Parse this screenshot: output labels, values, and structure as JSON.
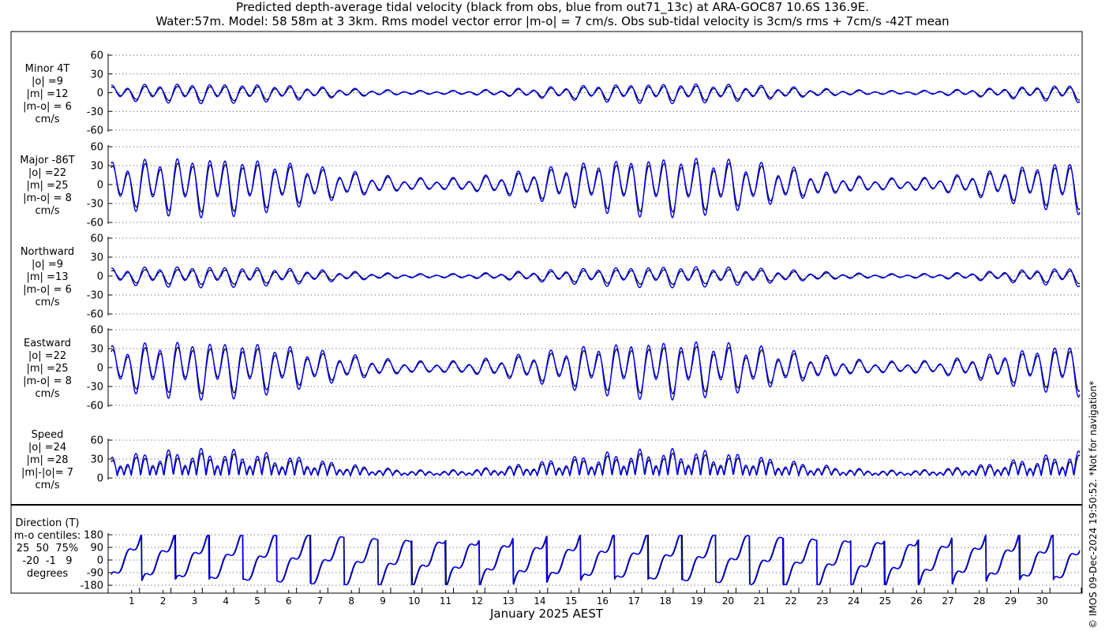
{
  "title_line1": "Predicted depth-average tidal velocity (black from obs, blue from out71_13c) at ARA-GOC87 10.6S 136.9E.",
  "title_line2": "Water:57m. Model: 58 58m at 3 3km. Rms model vector error |m-o| = 7 cm/s. Obs sub-tidal velocity is 3cm/s rms + 7cm/s -42T mean",
  "credit": "© IMOS 09-Dec-2024 19:50:52. *Not for navigation*",
  "xlabel": "January 2025 AEST",
  "colors": {
    "obs": "#000000",
    "model": "#0000ff"
  },
  "chart_data": [
    {
      "type": "line",
      "id": "minor",
      "label_lines": [
        "Minor 4T",
        "|o| =9",
        "|m| =12",
        "|m-o| = 6",
        "cm/s"
      ],
      "ylim": [
        -60,
        60
      ],
      "yticks": [
        -60,
        -30,
        0,
        30,
        60
      ],
      "series": [
        {
          "name": "obs",
          "amplitude": 12,
          "phase_deg": 0,
          "ref": "obs"
        },
        {
          "name": "model",
          "amplitude": 16,
          "phase_deg": 12,
          "ref": "model"
        }
      ]
    },
    {
      "type": "line",
      "id": "major",
      "label_lines": [
        "Major -86T",
        "|o| =22",
        "|m| =25",
        "|m-o| = 8",
        "cm/s"
      ],
      "ylim": [
        -60,
        60
      ],
      "yticks": [
        -60,
        -30,
        0,
        30,
        60
      ],
      "series": [
        {
          "name": "obs",
          "amplitude": 40,
          "phase_deg": 0,
          "ref": "obs"
        },
        {
          "name": "model",
          "amplitude": 48,
          "phase_deg": 8,
          "ref": "model"
        }
      ]
    },
    {
      "type": "line",
      "id": "north",
      "label_lines": [
        "Northward",
        "|o| =9",
        "|m| =13",
        "|m-o| = 6",
        "cm/s"
      ],
      "ylim": [
        -60,
        60
      ],
      "yticks": [
        -60,
        -30,
        0,
        30,
        60
      ],
      "series": [
        {
          "name": "obs",
          "amplitude": 12,
          "phase_deg": 0,
          "ref": "obs"
        },
        {
          "name": "model",
          "amplitude": 17,
          "phase_deg": 12,
          "ref": "model"
        }
      ]
    },
    {
      "type": "line",
      "id": "east",
      "label_lines": [
        "Eastward",
        "|o| =22",
        "|m| =25",
        "|m-o| = 8",
        "cm/s"
      ],
      "ylim": [
        -60,
        60
      ],
      "yticks": [
        -60,
        -30,
        0,
        30,
        60
      ],
      "series": [
        {
          "name": "obs",
          "amplitude": 38,
          "phase_deg": 0,
          "ref": "obs"
        },
        {
          "name": "model",
          "amplitude": 47,
          "phase_deg": 8,
          "ref": "model"
        }
      ]
    },
    {
      "type": "line",
      "id": "speed",
      "label_lines": [
        "Speed",
        "|o| =24",
        "|m| =28",
        "|m|-|o|= 7",
        "cm/s"
      ],
      "ylim": [
        0,
        60
      ],
      "yticks": [
        0,
        30,
        60
      ],
      "series": [
        {
          "name": "obs",
          "amplitude": 38,
          "phase_deg": 0,
          "ref": "obs"
        },
        {
          "name": "model",
          "amplitude": 46,
          "phase_deg": 8,
          "ref": "model"
        }
      ]
    },
    {
      "type": "line",
      "id": "direction",
      "label_lines": [
        "Direction (T)",
        "m-o centiles:",
        "25  50  75%",
        "-20  -1   9",
        "degrees"
      ],
      "ylim": [
        -180,
        180
      ],
      "yticks": [
        -180,
        -90,
        0,
        90,
        180
      ],
      "series": [
        {
          "name": "obs",
          "ref": "obs"
        },
        {
          "name": "model",
          "ref": "model"
        }
      ]
    }
  ],
  "x_axis": {
    "days": [
      "1",
      "2",
      "3",
      "4",
      "5",
      "6",
      "7",
      "8",
      "9",
      "10",
      "11",
      "12",
      "13",
      "14",
      "15",
      "16",
      "17",
      "18",
      "19",
      "20",
      "21",
      "22",
      "23",
      "24",
      "25",
      "26",
      "27",
      "28",
      "29",
      "30"
    ],
    "range_days": [
      0,
      31
    ]
  }
}
